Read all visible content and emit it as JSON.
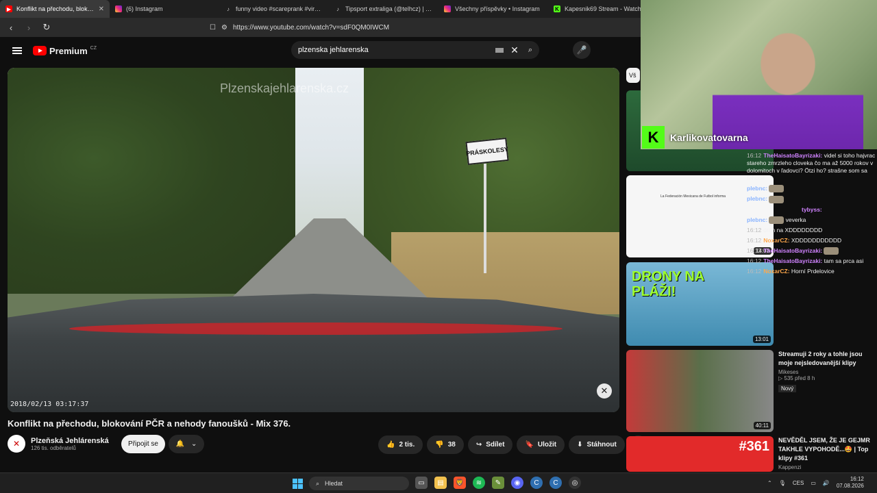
{
  "browser": {
    "tabs": [
      {
        "title": "Konflikt na přechodu, blokování",
        "icon": "youtube-icon",
        "active": true,
        "close": "✕"
      },
      {
        "title": "(6) Instagram",
        "icon": "instagram-icon"
      },
      {
        "title": "funny video #scareprank #viral #fal",
        "icon": "tiktok-icon"
      },
      {
        "title": "Tipsport extraliga (@telhcz) | TikTok",
        "icon": "tiktok-icon"
      },
      {
        "title": "Všechny příspěvky • Instagram",
        "icon": "instagram-icon"
      },
      {
        "title": "Kapesnik69 Stream - Watch",
        "icon": "kick-icon"
      }
    ],
    "url": "https://www.youtube.com/watch?v=sdF0QM0IWCM"
  },
  "youtube": {
    "logo_text": "Premium",
    "logo_region": "CZ",
    "search_value": "plzenska jehlarenska",
    "video": {
      "watermark": "Plzenskajehlarenska.cz",
      "sign_text": "PRÁSKOLESY",
      "timestamp": "2018/02/13  03:17:37",
      "title": "Konflikt na přechodu, blokování PČR a nehody fanoušků - Mix 376."
    },
    "channel": {
      "name": "Plzeňská Jehlárenská",
      "subscribers": "126 tis. odběratelů",
      "subscribe_label": "Připojit se"
    },
    "actions": {
      "likes": "2 tis.",
      "dislikes": "38",
      "share": "Sdílet",
      "save": "Uložit",
      "download": "Stáhnout"
    },
    "chip_label": "Vš",
    "recommendations": [
      {
        "duration": "",
        "title": "",
        "channel": "",
        "views": ""
      },
      {
        "duration": "14:03",
        "title": "",
        "channel": "",
        "views": "",
        "thumb_text": "La Federación Mexicana de Futbol informa"
      },
      {
        "duration": "13:01",
        "title": "",
        "channel": "",
        "views": "",
        "thumb_text": "DRONY NA PLÁŽI!"
      },
      {
        "duration": "40:11",
        "title": "Streamuji 2 roky a tohle jsou moje nejsledovanější klipy",
        "channel": "Mikeses",
        "views": "▷ 535  před 8 h",
        "badge": "Nový"
      },
      {
        "duration": "",
        "title": "NEVĚDĚL JSEM, ŽE JE GEJMR TAKHLE VYPOHODĚ...🤩 | Top klipy #361",
        "channel": "Kappenzi",
        "views": "",
        "thumb_text": "#361"
      }
    ]
  },
  "stream": {
    "streamer": "Karlikovatovarna",
    "chat": [
      {
        "time": "16:12",
        "user": "TheHaisatoBayrizaki:",
        "text": "videl si toho hajvrac stareho zmrzleho cloveka čo ma až 5000 rokov v dolomitoch v ľadovci? Ötzi ho? strašne som sa řehotal",
        "color": "p"
      },
      {
        "time": "",
        "user": "plebnc:",
        "text": "",
        "color": "b"
      },
      {
        "time": "",
        "user": "plebnc:",
        "text": "",
        "color": "b"
      },
      {
        "time": "",
        "user": "tybyss:",
        "text": "",
        "color": "p"
      },
      {
        "time": "",
        "user": "plebnc:",
        "text": "veverka",
        "color": "b"
      },
      {
        "time": "16:12",
        "user": "",
        "text": "dron na XDDDDDDDD",
        "color": "b"
      },
      {
        "time": "16:12",
        "user": "NoxarCZ:",
        "text": "XDDDDDDDDDDD",
        "color": "o"
      },
      {
        "time": "16:12",
        "user": "TheHaisatoBayrizaki:",
        "text": "",
        "color": "p"
      },
      {
        "time": "16:12",
        "user": "TheHaisatoBayrizaki:",
        "text": "tam sa prca asi",
        "color": "p"
      },
      {
        "time": "16:12",
        "user": "NoxarCZ:",
        "text": "Horní Prdelovice",
        "color": "o"
      }
    ]
  },
  "taskbar": {
    "search_placeholder": "Hledat",
    "language": "CES",
    "time": "16:12",
    "date": "07.08.2026"
  }
}
